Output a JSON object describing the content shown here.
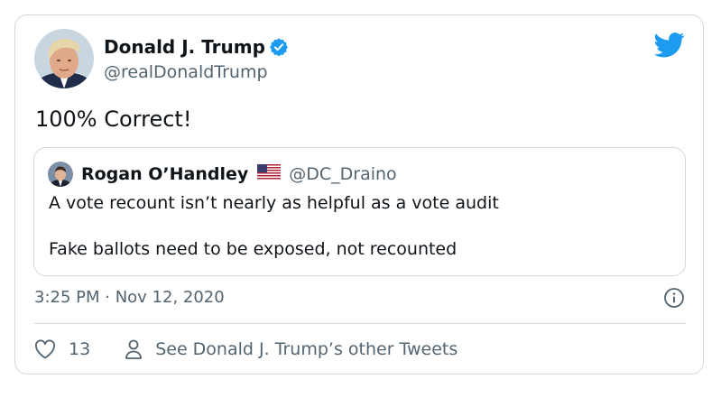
{
  "tweet": {
    "author": {
      "name": "Donald J. Trump",
      "handle": "@realDonaldTrump",
      "verified": true,
      "verified_color": "#1d9bf0"
    },
    "text": "100% Correct!",
    "timestamp": "3:25 PM · Nov 12, 2020",
    "brand_color": "#1d9bf0"
  },
  "quote": {
    "author_name": "Rogan O’Handley",
    "flag_icon": "us-flag-icon",
    "handle": "@DC_Draino",
    "line1": "A vote recount isn’t nearly as helpful as a vote audit",
    "line2": "Fake ballots need to be exposed, not recounted"
  },
  "actions": {
    "like_icon": "heart-icon",
    "like_count": "13",
    "profile_icon": "person-icon",
    "other_tweets_label": "See Donald J. Trump’s other Tweets"
  },
  "icons": {
    "twitter_logo": "twitter-bird-icon",
    "info": "info-icon"
  }
}
